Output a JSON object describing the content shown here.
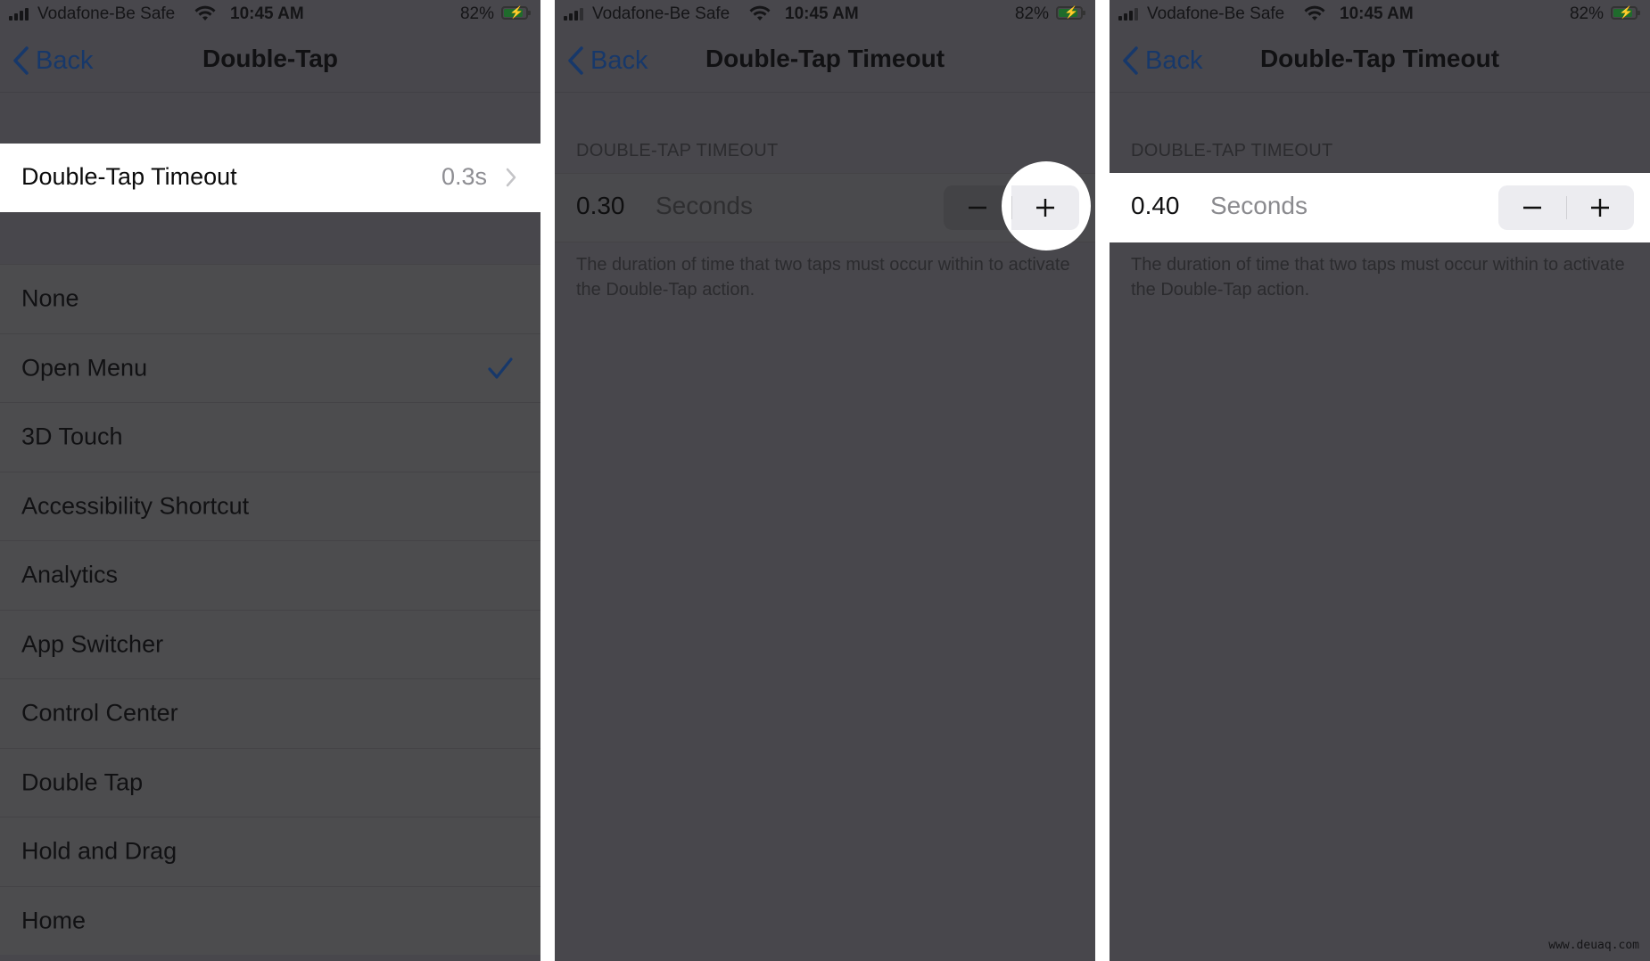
{
  "status_bar": {
    "carrier": "Vodafone-Be Safe",
    "time": "10:45 AM",
    "battery_percent": "82%",
    "battery_level": 0.82,
    "signal_bars": 4,
    "signal_active_bars": 3,
    "battery_color": "#1f6b2c"
  },
  "colors": {
    "accent": "#17386a",
    "dim_background": "#48474c",
    "highlight": "#ffffff"
  },
  "panel1": {
    "back_label": "Back",
    "title": "Double-Tap",
    "timeout_row": {
      "label": "Double-Tap Timeout",
      "value": "0.3s"
    },
    "actions": [
      {
        "label": "None",
        "selected": false
      },
      {
        "label": "Open Menu",
        "selected": true
      },
      {
        "label": "3D Touch",
        "selected": false
      },
      {
        "label": "Accessibility Shortcut",
        "selected": false
      },
      {
        "label": "Analytics",
        "selected": false
      },
      {
        "label": "App Switcher",
        "selected": false
      },
      {
        "label": "Control Center",
        "selected": false
      },
      {
        "label": "Double Tap",
        "selected": false
      },
      {
        "label": "Hold and Drag",
        "selected": false
      },
      {
        "label": "Home",
        "selected": false
      }
    ]
  },
  "panel2": {
    "back_label": "Back",
    "title": "Double-Tap Timeout",
    "section_header": "DOUBLE-TAP TIMEOUT",
    "value": "0.30",
    "unit": "Seconds",
    "decrement_icon": "minus-icon",
    "increment_icon": "plus-icon",
    "highlighted_control": "increment",
    "footer": "The duration of time that two taps must occur within to activate the Double-Tap action."
  },
  "panel3": {
    "back_label": "Back",
    "title": "Double-Tap Timeout",
    "section_header": "DOUBLE-TAP TIMEOUT",
    "value": "0.40",
    "unit": "Seconds",
    "decrement_icon": "minus-icon",
    "increment_icon": "plus-icon",
    "footer": "The duration of time that two taps must occur within to activate the Double-Tap action."
  },
  "watermark": "www.deuaq.com"
}
